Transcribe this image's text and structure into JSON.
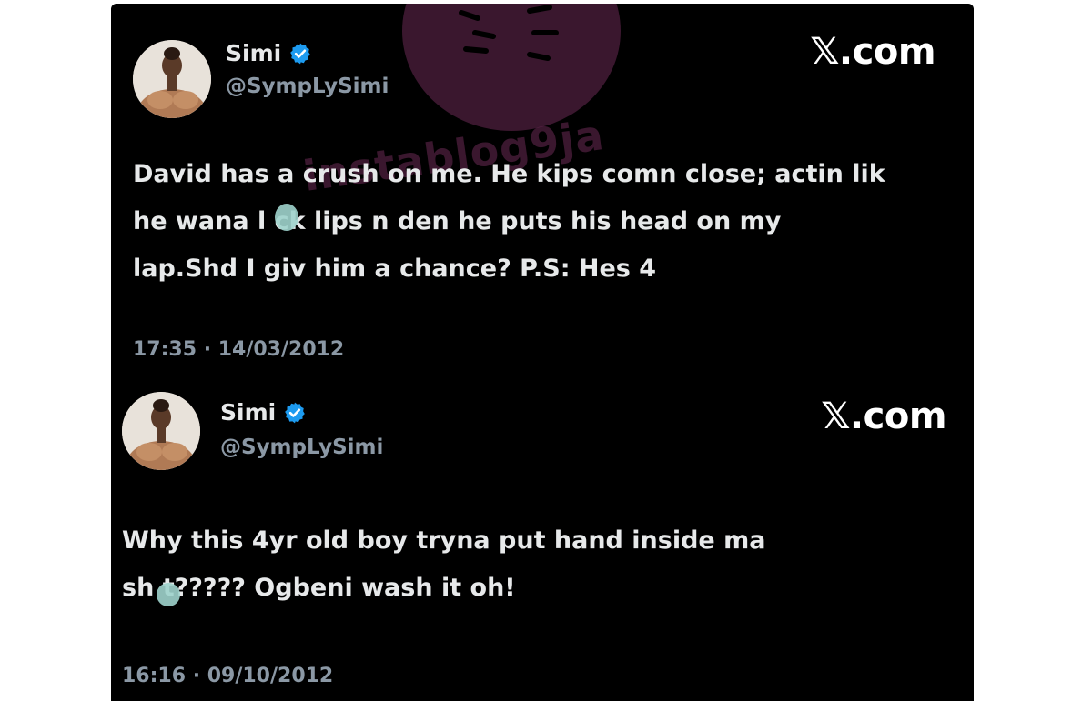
{
  "colors": {
    "card_background": "#000000",
    "page_background": "#ffffff",
    "text_primary": "#e7e9ea",
    "text_secondary": "#8b98a5",
    "verified_blue": "#1d9bf0",
    "watermark": "#6b2a55"
  },
  "tweets": [
    {
      "display_name": "Simi",
      "handle": "@SympLySimi",
      "brand": "𝕏.com",
      "text": "David has a crush on me. He kips comn close; actin lik\nhe wana l  ck lips n den he puts his head on my\nlap.Shd I giv him a chance? P.S: Hes 4",
      "timestamp": "17:35 · 14/03/2012",
      "verified_icon": "verified-badge-icon",
      "avatar_icon": "profile-photo"
    },
    {
      "display_name": "Simi",
      "handle": "@SympLySimi",
      "brand": "𝕏.com",
      "text": "Why this 4yr old boy tryna put hand inside ma\nsh  t????? Ogbeni wash it oh!",
      "timestamp": "16:16 · 09/10/2012",
      "verified_icon": "verified-badge-icon",
      "avatar_icon": "profile-photo"
    }
  ],
  "watermark": {
    "text": "instablog9ja"
  }
}
